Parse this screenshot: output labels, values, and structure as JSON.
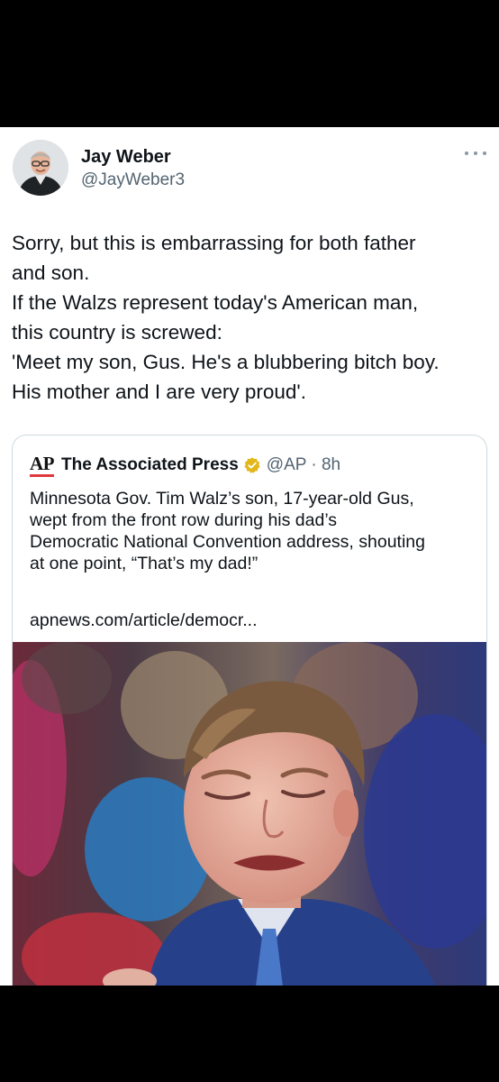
{
  "tweet": {
    "author": {
      "display_name": "Jay Weber",
      "handle": "@JayWeber3"
    },
    "text_lines": [
      "Sorry, but this is embarrassing for both father",
      "and son.",
      "If the Walzs represent today's American man,",
      "this country is screwed:",
      "'Meet my son, Gus. He's a blubbering bitch boy.",
      "His mother and I are very proud'."
    ],
    "more_icon": "more-horizontal-icon"
  },
  "quote": {
    "logo_text": "AP",
    "author_name": "The Associated Press",
    "verified_icon": "verified-badge-icon",
    "verified_color": "#e2b719",
    "handle_time": "@AP · 8h",
    "text_lines": [
      "Minnesota Gov. Tim Walz’s son, 17-year-old Gus,",
      "wept from the front row during his dad’s",
      "Democratic National Convention address, shouting",
      "at one point, “That’s my dad!”"
    ],
    "link_text": "apnews.com/article/democr...",
    "image_subject": "photo-crying-young-man"
  },
  "colors": {
    "background": "#000000",
    "card": "#ffffff",
    "text_primary": "#0f1419",
    "text_secondary": "#536471",
    "border": "#cfd9de",
    "ap_red": "#e03a3e"
  }
}
